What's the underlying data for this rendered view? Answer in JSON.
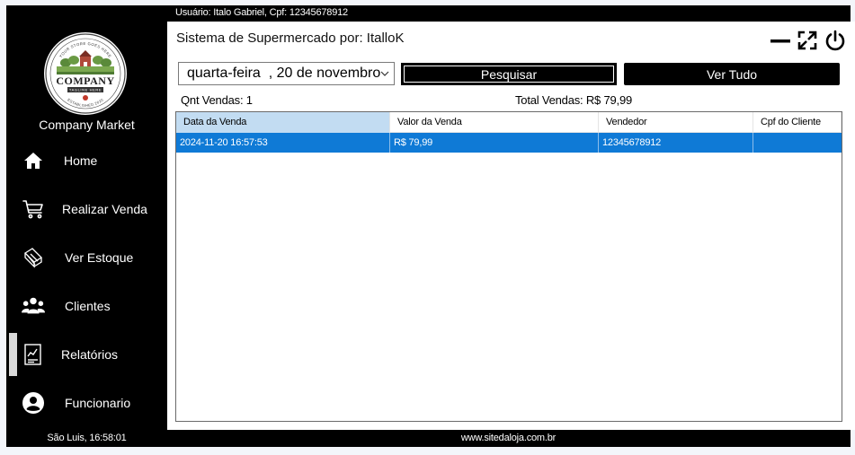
{
  "topbar": {
    "user_info": "Usuário: Italo Gabriel, Cpf: 12345678912"
  },
  "sidebar": {
    "logo": {
      "arc_text": "YOUR STORE GOES HERE",
      "brand": "COMPANY",
      "tagline": "TAGLINE HERE",
      "established": "ESTABLISHED 2020"
    },
    "company_name": "Company Market",
    "items": [
      {
        "label": "Home",
        "icon": "home-icon"
      },
      {
        "label": "Realizar Venda",
        "icon": "cart-icon"
      },
      {
        "label": "Ver Estoque",
        "icon": "stock-icon"
      },
      {
        "label": "Clientes",
        "icon": "users-icon"
      },
      {
        "label": "Relatórios",
        "icon": "report-icon"
      },
      {
        "label": "Funcionario",
        "icon": "user-icon"
      }
    ],
    "active_item": "Relatórios"
  },
  "header": {
    "title": "Sistema de Supermercado por: ItalloK"
  },
  "filters": {
    "date_value": "quarta-feira  , 20 de novembro",
    "search_label": "Pesquisar",
    "show_all_label": "Ver Tudo"
  },
  "summary": {
    "qnt_vendas": "Qnt Vendas: 1",
    "total_vendas": "Total Vendas: R$ 79,99"
  },
  "table": {
    "columns": [
      "Data da Venda",
      "Valor da Venda",
      "Vendedor",
      "Cpf do Cliente"
    ],
    "rows": [
      [
        "2024-11-20 16:57:53",
        "R$ 79,99",
        "12345678912",
        ""
      ]
    ]
  },
  "footer": {
    "left": "São Luis, 16:58:01",
    "site": "www.sitedaloja.com.br"
  },
  "colors": {
    "sidebar_bg": "#000000",
    "selected_row": "#0f7ad6",
    "header_selected": "#c2dcf2"
  }
}
